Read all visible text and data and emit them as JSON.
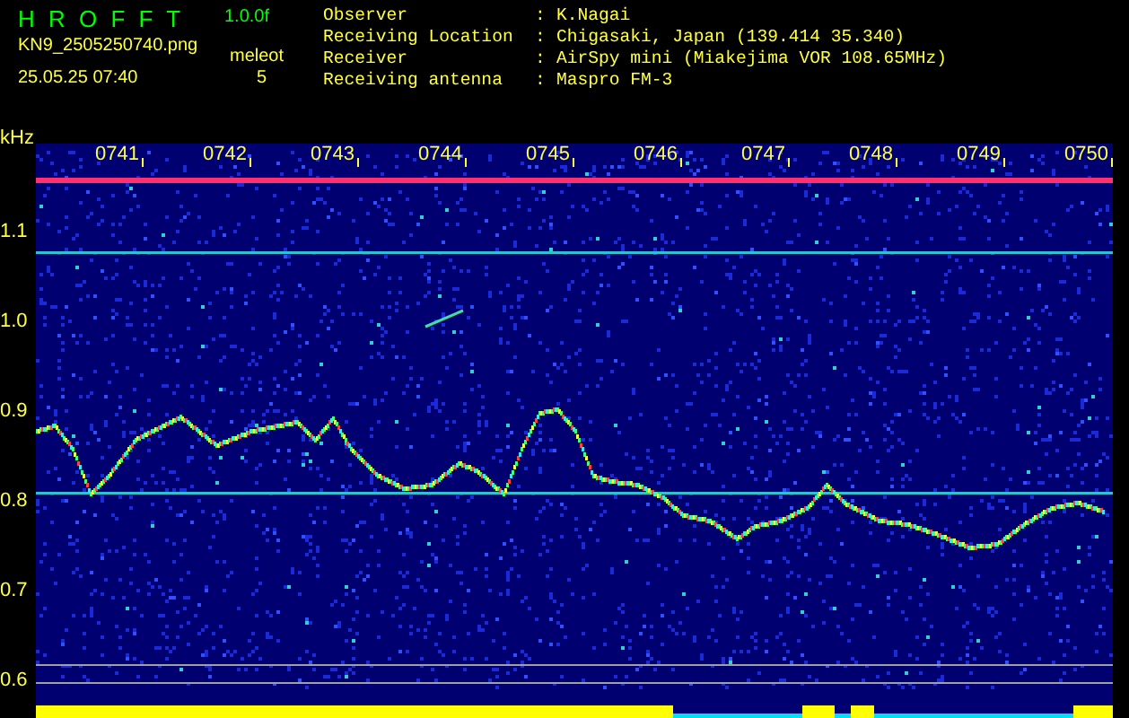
{
  "app": {
    "title": "H R O F F T",
    "version": "1.0.0f"
  },
  "file": {
    "filename": "KN9_2505250740.png",
    "mode": "meleot",
    "timestamp": "25.05.25 07:40",
    "count": "5"
  },
  "info": [
    {
      "label": "Observer",
      "separator": ":",
      "value": "K.Nagai"
    },
    {
      "label": "Receiving Location",
      "separator": ":",
      "value": "Chigasaki, Japan (139.414 35.340)"
    },
    {
      "label": "Receiver",
      "separator": ":",
      "value": "AirSpy mini (Miakejima VOR 108.65MHz)"
    },
    {
      "label": "Receiving antenna",
      "separator": ":",
      "value": "Maspro FM-3"
    }
  ],
  "spectrogram": {
    "unit": "kHz",
    "time_labels": [
      "0741",
      "0742",
      "0743",
      "0744",
      "0745",
      "0746",
      "0747",
      "0748",
      "0749",
      "0750"
    ],
    "freq_labels": [
      "1.1",
      "1.0",
      "0.9",
      "0.8",
      "0.7",
      "0.6"
    ]
  }
}
